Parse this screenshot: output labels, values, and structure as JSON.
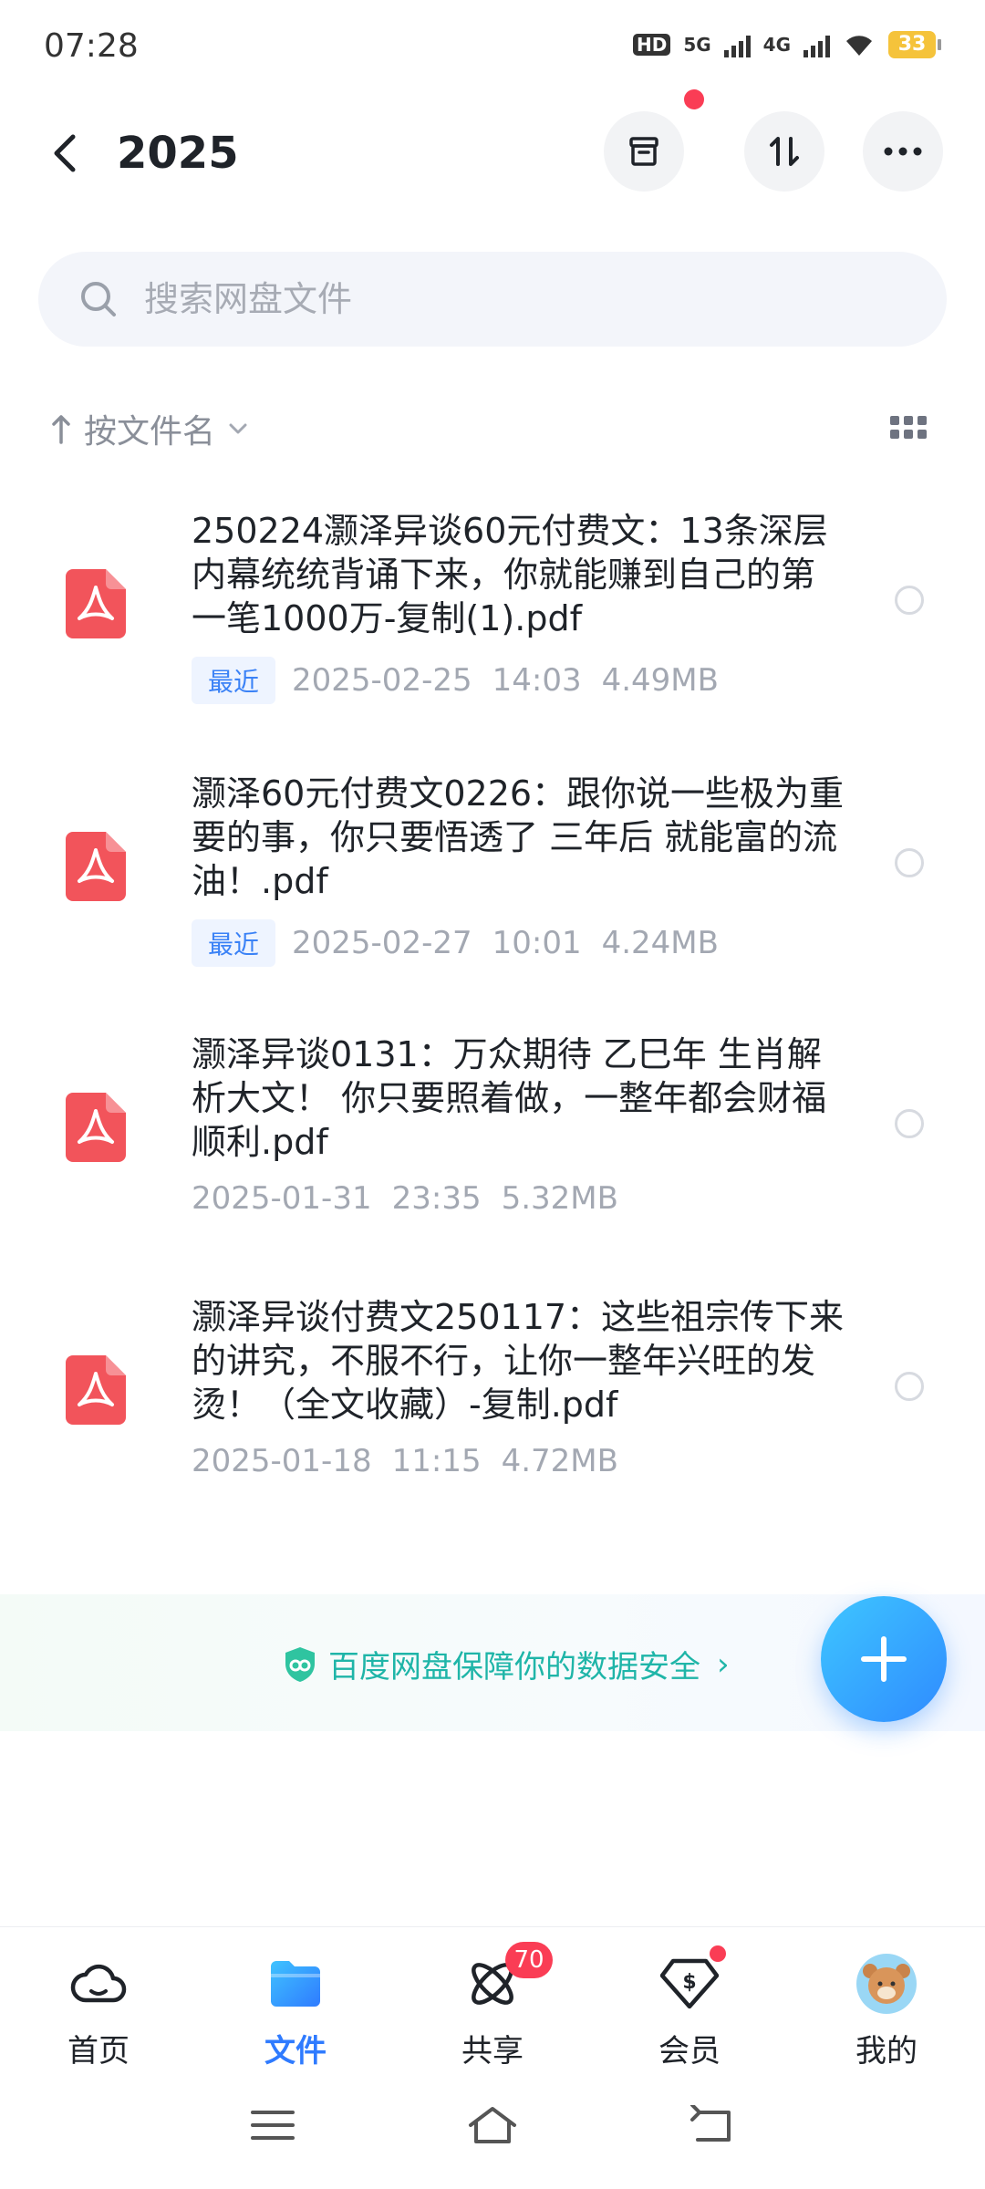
{
  "status_bar": {
    "time": "07:28",
    "hd": "HD",
    "network_5g": "5G",
    "network_4g": "4G",
    "battery": "33"
  },
  "header": {
    "title": "2025"
  },
  "search": {
    "placeholder": "搜索网盘文件"
  },
  "sort": {
    "label": "按文件名"
  },
  "files": [
    {
      "name": "250224灏泽异谈60元付费文：13条深层内幕统统背诵下来，你就能赚到自己的第一笔1000万-复制(1).pdf",
      "tag": "最近",
      "date": "2025-02-25",
      "time": "14:03",
      "size": "4.49MB"
    },
    {
      "name": "灏泽60元付费文0226：跟你说一些极为重要的事，你只要悟透了 三年后 就能富的流油！.pdf",
      "tag": "最近",
      "date": "2025-02-27",
      "time": "10:01",
      "size": "4.24MB"
    },
    {
      "name": "灏泽异谈0131：万众期待 乙巳年 生肖解析大文！ 你只要照着做，一整年都会财福顺利.pdf",
      "tag": "",
      "date": "2025-01-31",
      "time": "23:35",
      "size": "5.32MB"
    },
    {
      "name": "灏泽异谈付费文250117：这些祖宗传下来的讲究，不服不行，让你一整年兴旺的发烫！（全文收藏）-复制.pdf",
      "tag": "",
      "date": "2025-01-18",
      "time": "11:15",
      "size": "4.72MB"
    }
  ],
  "security": {
    "text": "百度网盘保障你的数据安全",
    "arrow": "›"
  },
  "bottom_nav": [
    {
      "label": "首页",
      "icon": "cloud-icon",
      "active": false
    },
    {
      "label": "文件",
      "icon": "folder-icon",
      "active": true
    },
    {
      "label": "共享",
      "icon": "share-atom-icon",
      "active": false,
      "badge": "70"
    },
    {
      "label": "会员",
      "icon": "vip-icon",
      "active": false
    },
    {
      "label": "我的",
      "icon": "avatar-icon",
      "active": false
    }
  ],
  "colors": {
    "accent": "#2f7bff",
    "pdf": "#f2545b",
    "badge": "#fa3d55",
    "security": "#1fb5a8"
  }
}
